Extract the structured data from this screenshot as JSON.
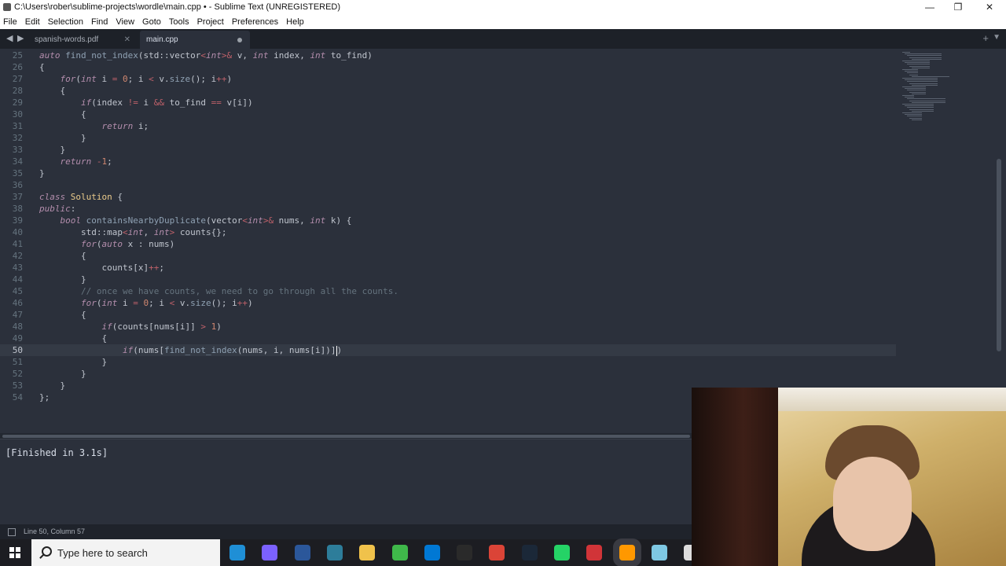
{
  "window": {
    "title": "C:\\Users\\rober\\sublime-projects\\wordle\\main.cpp • - Sublime Text (UNREGISTERED)",
    "controls": [
      "—",
      "❐",
      "✕"
    ]
  },
  "menu": [
    "File",
    "Edit",
    "Selection",
    "Find",
    "View",
    "Goto",
    "Tools",
    "Project",
    "Preferences",
    "Help"
  ],
  "tabs": [
    {
      "label": "spanish-words.pdf",
      "active": false
    },
    {
      "label": "main.cpp",
      "active": true
    }
  ],
  "editor": {
    "lines": [
      {
        "n": "25",
        "code": "auto find_not_index(std::vector<int>& v, int index, int to_find)"
      },
      {
        "n": "26",
        "code": "{"
      },
      {
        "n": "27",
        "code": "    for(int i = 0; i < v.size(); i++)"
      },
      {
        "n": "28",
        "code": "    {"
      },
      {
        "n": "29",
        "code": "        if(index != i && to_find == v[i])"
      },
      {
        "n": "30",
        "code": "        {"
      },
      {
        "n": "31",
        "code": "            return i;"
      },
      {
        "n": "32",
        "code": "        }"
      },
      {
        "n": "33",
        "code": "    }"
      },
      {
        "n": "34",
        "code": "    return -1;"
      },
      {
        "n": "35",
        "code": "}"
      },
      {
        "n": "36",
        "code": ""
      },
      {
        "n": "37",
        "code": "class Solution {"
      },
      {
        "n": "38",
        "code": "public:"
      },
      {
        "n": "39",
        "code": "    bool containsNearbyDuplicate(vector<int>& nums, int k) {"
      },
      {
        "n": "40",
        "code": "        std::map<int, int> counts{};"
      },
      {
        "n": "41",
        "code": "        for(auto x : nums)"
      },
      {
        "n": "42",
        "code": "        {"
      },
      {
        "n": "43",
        "code": "            counts[x]++;"
      },
      {
        "n": "44",
        "code": "        }"
      },
      {
        "n": "45",
        "code": "        // once we have counts, we need to go through all the counts."
      },
      {
        "n": "46",
        "code": "        for(int i = 0; i < v.size(); i++)"
      },
      {
        "n": "47",
        "code": "        {"
      },
      {
        "n": "48",
        "code": "            if(counts[nums[i]] > 1)"
      },
      {
        "n": "49",
        "code": "            {"
      },
      {
        "n": "50",
        "code": "                if(nums[find_not_index(nums, i, nums[i])])"
      },
      {
        "n": "51",
        "code": "            }"
      },
      {
        "n": "52",
        "code": "        }"
      },
      {
        "n": "53",
        "code": "    }"
      },
      {
        "n": "54",
        "code": "};"
      }
    ],
    "current_line": "50"
  },
  "output": {
    "text": "[Finished in 3.1s]"
  },
  "status": {
    "position": "Line 50, Column 57"
  },
  "taskbar": {
    "search_placeholder": "Type here to search",
    "apps": [
      "edge-icon",
      "copilot-icon",
      "word-icon",
      "store-icon",
      "explorer-icon",
      "sync-icon",
      "vscode-icon",
      "github-icon",
      "chrome-icon",
      "steam-icon",
      "whatsapp-icon",
      "pdf-icon",
      "sublime-icon",
      "notepad-icon",
      "settings-icon"
    ]
  },
  "colors": {
    "editor_bg": "#2b303b",
    "keyword": "#b48ead",
    "function": "#8fa1b3",
    "type": "#b48ead",
    "number": "#d08770",
    "string": "#a3be8c",
    "operator": "#c0c5ce"
  }
}
